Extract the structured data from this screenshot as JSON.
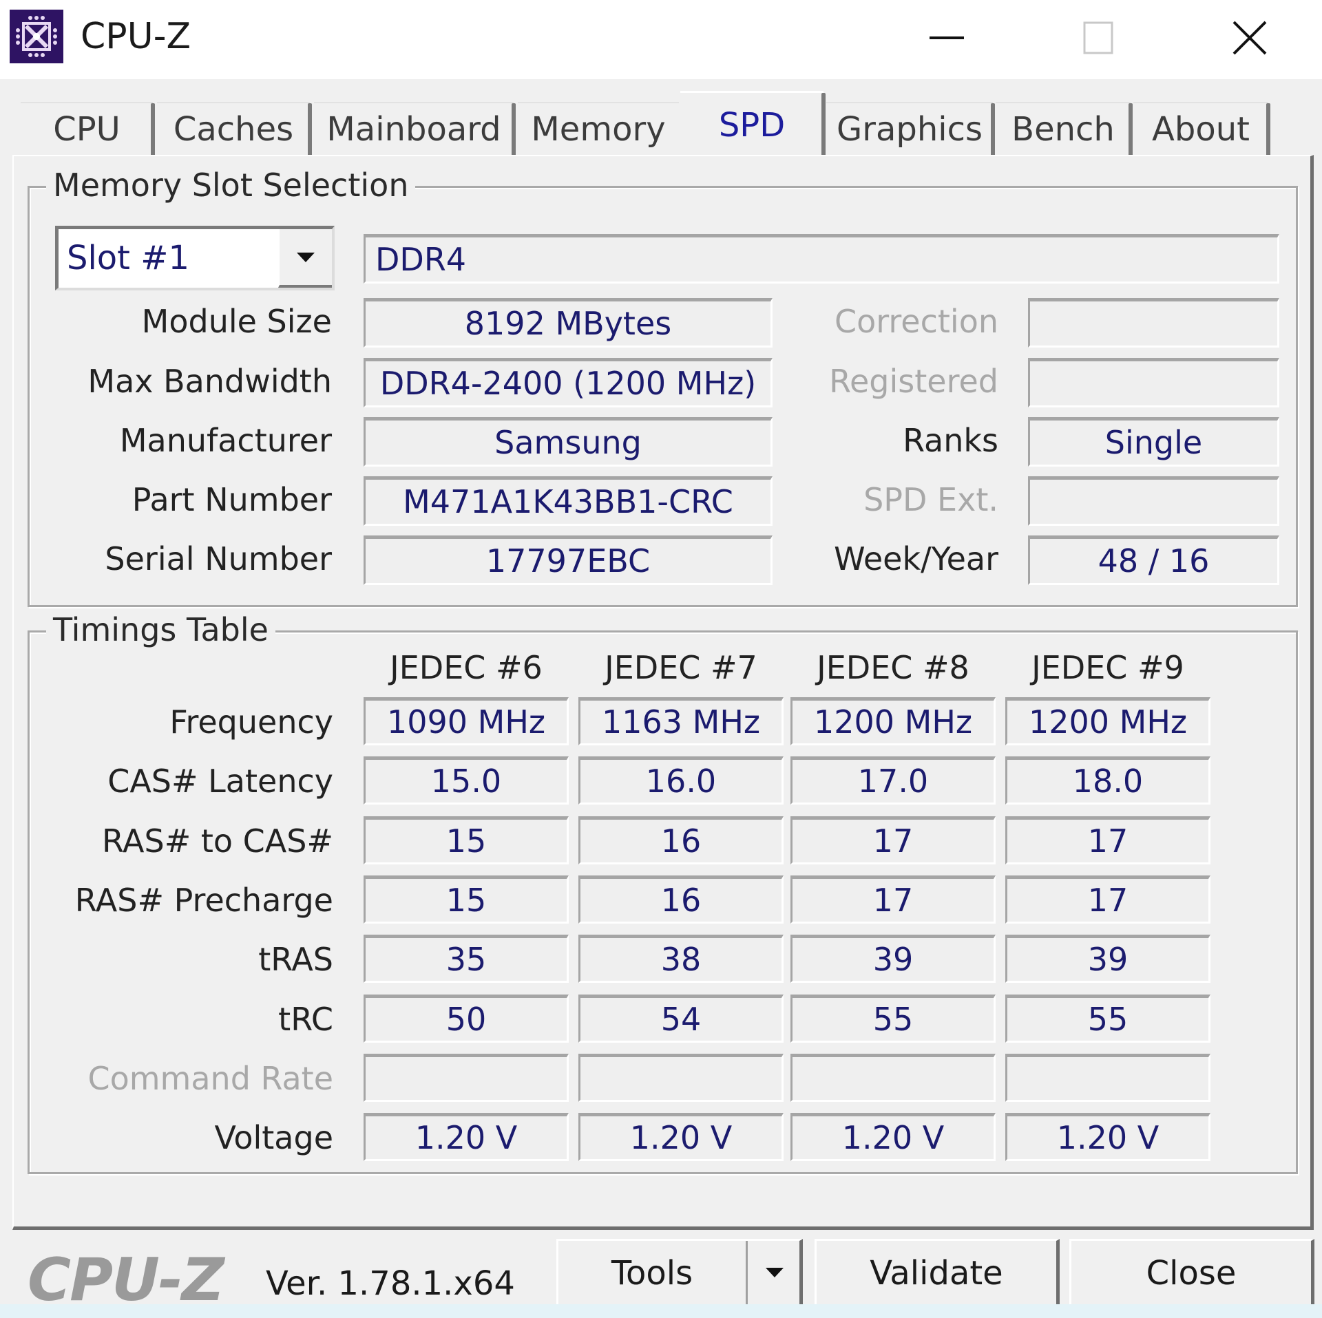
{
  "window": {
    "title": "CPU-Z",
    "icon": "cpu-chip-icon",
    "controls": {
      "minimize": "minimize-icon",
      "maximize": "maximize-icon",
      "close": "close-icon"
    }
  },
  "tabs": [
    {
      "label": "CPU",
      "selected": false
    },
    {
      "label": "Caches",
      "selected": false
    },
    {
      "label": "Mainboard",
      "selected": false
    },
    {
      "label": "Memory",
      "selected": false
    },
    {
      "label": "SPD",
      "selected": true
    },
    {
      "label": "Graphics",
      "selected": false
    },
    {
      "label": "Bench",
      "selected": false
    },
    {
      "label": "About",
      "selected": false
    }
  ],
  "slot_selection": {
    "group_title": "Memory Slot Selection",
    "slot": "Slot #1",
    "memory_type": "DDR4",
    "left_fields": [
      {
        "label": "Module Size",
        "value": "8192 MBytes"
      },
      {
        "label": "Max Bandwidth",
        "value": "DDR4-2400 (1200 MHz)"
      },
      {
        "label": "Manufacturer",
        "value": "Samsung"
      },
      {
        "label": "Part Number",
        "value": "M471A1K43BB1-CRC"
      },
      {
        "label": "Serial Number",
        "value": "17797EBC"
      }
    ],
    "right_fields": [
      {
        "label": "Correction",
        "value": "",
        "disabled": true
      },
      {
        "label": "Registered",
        "value": "",
        "disabled": true
      },
      {
        "label": "Ranks",
        "value": "Single",
        "disabled": false
      },
      {
        "label": "SPD Ext.",
        "value": "",
        "disabled": true
      },
      {
        "label": "Week/Year",
        "value": "48 / 16",
        "disabled": false
      }
    ]
  },
  "timings": {
    "group_title": "Timings Table",
    "columns": [
      "JEDEC #6",
      "JEDEC #7",
      "JEDEC #8",
      "JEDEC #9"
    ],
    "rows": [
      {
        "label": "Frequency",
        "disabled": false,
        "values": [
          "1090 MHz",
          "1163 MHz",
          "1200 MHz",
          "1200 MHz"
        ]
      },
      {
        "label": "CAS# Latency",
        "disabled": false,
        "values": [
          "15.0",
          "16.0",
          "17.0",
          "18.0"
        ]
      },
      {
        "label": "RAS# to CAS#",
        "disabled": false,
        "values": [
          "15",
          "16",
          "17",
          "17"
        ]
      },
      {
        "label": "RAS# Precharge",
        "disabled": false,
        "values": [
          "15",
          "16",
          "17",
          "17"
        ]
      },
      {
        "label": "tRAS",
        "disabled": false,
        "values": [
          "35",
          "38",
          "39",
          "39"
        ]
      },
      {
        "label": "tRC",
        "disabled": false,
        "values": [
          "50",
          "54",
          "55",
          "55"
        ]
      },
      {
        "label": "Command Rate",
        "disabled": true,
        "values": [
          "",
          "",
          "",
          ""
        ]
      },
      {
        "label": "Voltage",
        "disabled": false,
        "values": [
          "1.20 V",
          "1.20 V",
          "1.20 V",
          "1.20 V"
        ]
      }
    ]
  },
  "footer": {
    "logo": "CPU-Z",
    "version": "Ver. 1.78.1.x64",
    "tools_label": "Tools",
    "validate_label": "Validate",
    "close_label": "Close"
  },
  "colors": {
    "value_text": "#1b1b6e",
    "selected_tab_text": "#1c1c9c",
    "icon_bg": "#2e1363"
  }
}
